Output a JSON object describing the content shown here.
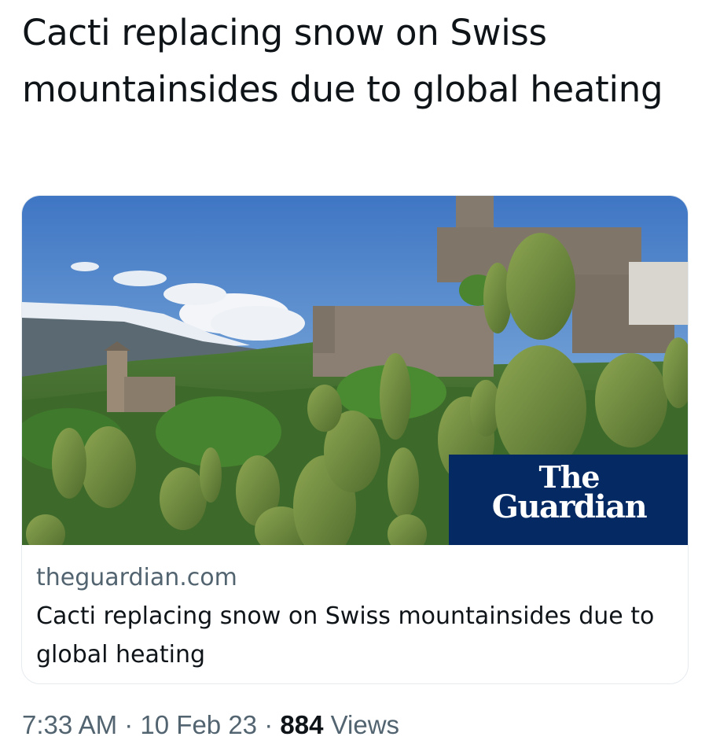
{
  "tweet": {
    "text": "Cacti replacing snow on Swiss mountainsides due to global heating"
  },
  "card": {
    "badge_line1": "The",
    "badge_line2": "Guardian",
    "domain": "theguardian.com",
    "title": "Cacti replacing snow on Swiss mountainsides due to global heating"
  },
  "meta": {
    "time": "7:33 AM",
    "separator": "·",
    "date": "10 Feb 23",
    "views_count": "884",
    "views_label": "Views"
  },
  "colors": {
    "guardian_blue": "#052962",
    "text_primary": "#0f1419",
    "text_secondary": "#536471"
  }
}
